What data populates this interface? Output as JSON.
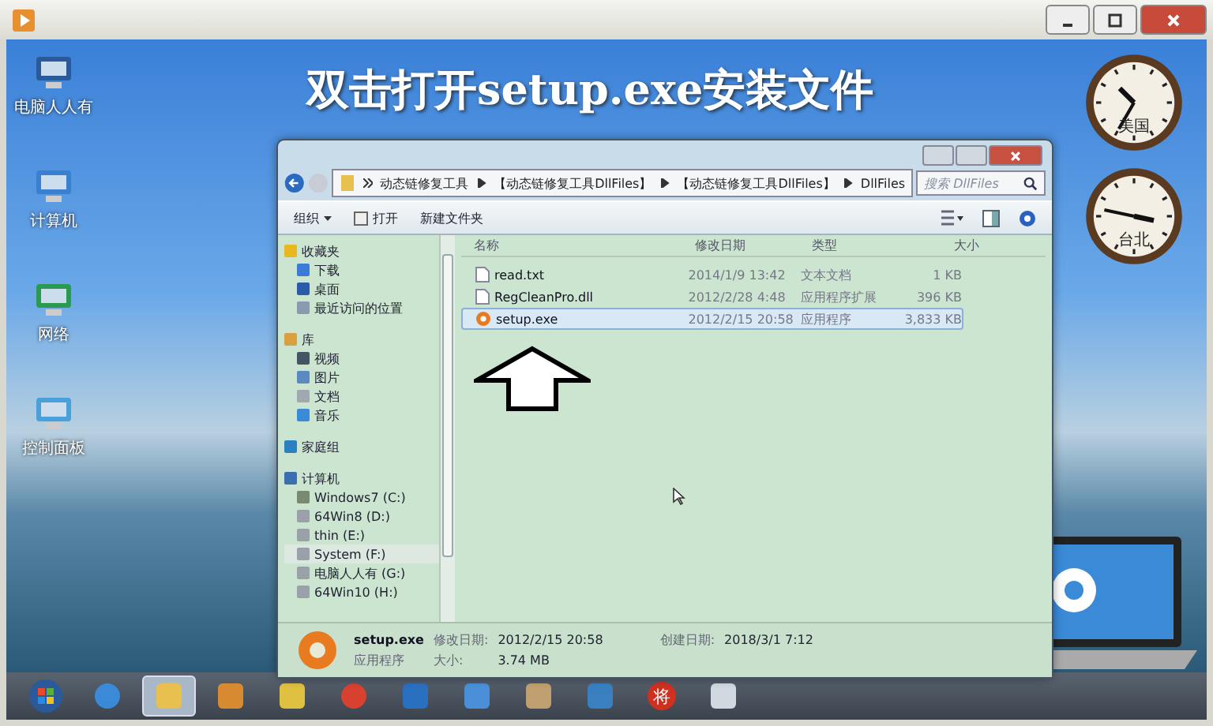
{
  "banner": "双击打开setup.exe安装文件",
  "desktop_icons": [
    {
      "label": "电脑人人有",
      "kind": "laptop"
    },
    {
      "label": "计算机",
      "kind": "computer"
    },
    {
      "label": "网络",
      "kind": "network"
    },
    {
      "label": "控制面板",
      "kind": "control"
    }
  ],
  "clocks": [
    {
      "label": "美国"
    },
    {
      "label": "台北"
    }
  ],
  "explorer": {
    "breadcrumbs": [
      "动态链修复工具",
      "【动态链修复工具DllFiles】",
      "【动态链修复工具DllFiles】",
      "DllFiles"
    ],
    "search": {
      "placeholder": "搜索 DllFiles"
    },
    "toolbar": [
      {
        "label": "组织",
        "kind": "menu"
      },
      {
        "label": "打开",
        "kind": "open"
      },
      {
        "label": "新建文件夹",
        "kind": "plain"
      }
    ],
    "nav": [
      {
        "label": "收藏夹",
        "kind": "star",
        "selected": false,
        "children": [
          {
            "label": "下载",
            "kind": "download",
            "selected": false
          },
          {
            "label": "桌面",
            "kind": "desktop",
            "selected": false
          },
          {
            "label": "最近访问的位置",
            "kind": "recent",
            "selected": false
          }
        ]
      },
      {
        "label": "库",
        "kind": "library",
        "selected": false,
        "children": [
          {
            "label": "视频",
            "kind": "video",
            "selected": false
          },
          {
            "label": "图片",
            "kind": "picture",
            "selected": false
          },
          {
            "label": "文档",
            "kind": "doc",
            "selected": false
          },
          {
            "label": "音乐",
            "kind": "music",
            "selected": false
          }
        ]
      },
      {
        "label": "家庭组",
        "kind": "homegroup",
        "selected": false
      },
      {
        "label": "计算机",
        "kind": "computer",
        "selected": false,
        "children": [
          {
            "label": "Windows7 (C:)",
            "kind": "sysdrive",
            "selected": false
          },
          {
            "label": "64Win8  (D:)",
            "kind": "drive",
            "selected": false
          },
          {
            "label": "thin (E:)",
            "kind": "drive",
            "selected": false
          },
          {
            "label": "System (F:)",
            "kind": "drive",
            "selected": true
          },
          {
            "label": "电脑人人有 (G:)",
            "kind": "drive",
            "selected": false
          },
          {
            "label": "64Win10 (H:)",
            "kind": "drive",
            "selected": false
          }
        ]
      }
    ],
    "columns": [
      "名称",
      "修改日期",
      "类型",
      "大小"
    ],
    "rows": [
      {
        "name": "read.txt",
        "kind": "text",
        "date": "2014/1/9 13:42",
        "type": "文本文档",
        "size": "1 KB",
        "selected": false
      },
      {
        "name": "RegCleanPro.dll",
        "kind": "dll",
        "date": "2012/2/28 4:48",
        "type": "应用程序扩展",
        "size": "396 KB",
        "selected": false
      },
      {
        "name": "setup.exe",
        "kind": "exe",
        "date": "2012/2/15 20:58",
        "type": "应用程序",
        "size": "3,833 KB",
        "selected": true
      }
    ],
    "details": {
      "name": "setup.exe",
      "type": "应用程序",
      "modified_label": "修改日期:",
      "modified": "2012/2/15 20:58",
      "created_label": "创建日期:",
      "created": "2018/3/1 7:12",
      "size_label": "大小:",
      "size": "3.74 MB"
    }
  },
  "taskbar": [
    {
      "kind": "start",
      "selected": false
    },
    {
      "kind": "ie",
      "selected": false
    },
    {
      "kind": "folder",
      "selected": true
    },
    {
      "kind": "media",
      "selected": false
    },
    {
      "kind": "notes",
      "selected": false
    },
    {
      "kind": "chrome",
      "selected": false
    },
    {
      "kind": "cloud",
      "selected": false
    },
    {
      "kind": "document",
      "selected": false
    },
    {
      "kind": "paint",
      "selected": false
    },
    {
      "kind": "remote",
      "selected": false
    },
    {
      "kind": "chess",
      "label": "将",
      "selected": false
    },
    {
      "kind": "flower",
      "selected": false
    }
  ]
}
